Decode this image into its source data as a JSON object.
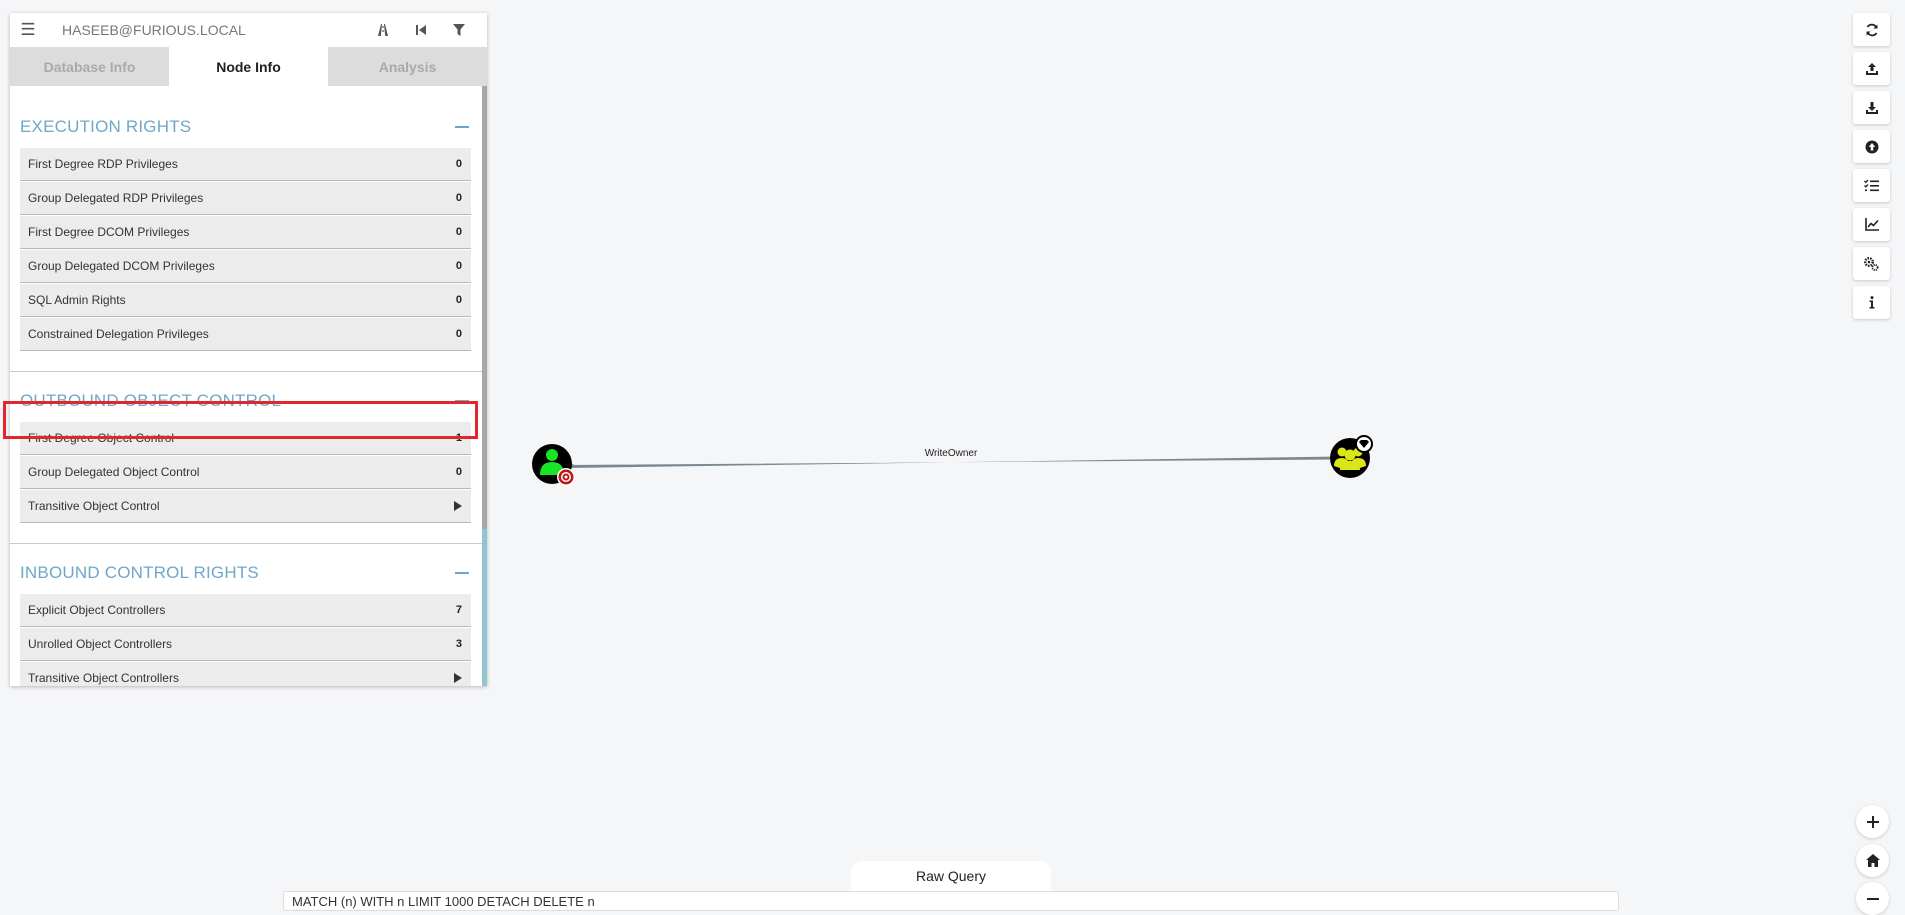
{
  "search": {
    "value": "HASEEB@FURIOUS.LOCAL"
  },
  "tabs": [
    {
      "label": "Database Info",
      "active": false
    },
    {
      "label": "Node Info",
      "active": true
    },
    {
      "label": "Analysis",
      "active": false
    }
  ],
  "sections": [
    {
      "title": "EXECUTION RIGHTS",
      "rows": [
        {
          "label": "First Degree RDP Privileges",
          "value": "0"
        },
        {
          "label": "Group Delegated RDP Privileges",
          "value": "0"
        },
        {
          "label": "First Degree DCOM Privileges",
          "value": "0"
        },
        {
          "label": "Group Delegated DCOM Privileges",
          "value": "0"
        },
        {
          "label": "SQL Admin Rights",
          "value": "0"
        },
        {
          "label": "Constrained Delegation Privileges",
          "value": "0"
        }
      ]
    },
    {
      "title": "OUTBOUND OBJECT CONTROL",
      "rows": [
        {
          "label": "First Degree Object Control",
          "value": "1"
        },
        {
          "label": "Group Delegated Object Control",
          "value": "0"
        },
        {
          "label": "Transitive Object Control",
          "value": ""
        }
      ]
    },
    {
      "title": "INBOUND CONTROL RIGHTS",
      "rows": [
        {
          "label": "Explicit Object Controllers",
          "value": "7"
        },
        {
          "label": "Unrolled Object Controllers",
          "value": "3"
        },
        {
          "label": "Transitive Object Controllers",
          "value": ""
        }
      ]
    }
  ],
  "graph": {
    "edge_label": "WriteOwner",
    "source_node_icon": "user-icon",
    "target_node_icon": "group-icon",
    "colors": {
      "user": "#17e625",
      "group": "#dbe617",
      "edge": "#7b8891",
      "highlight": "#e3262b"
    }
  },
  "toolbar_icons": [
    "refresh-icon",
    "upload-icon",
    "download-icon",
    "arrow-up-circle-icon",
    "checklist-icon",
    "line-chart-icon",
    "settings-icon",
    "info-icon"
  ],
  "zoom_icons": [
    "zoom-in-icon",
    "home-icon",
    "zoom-out-icon"
  ],
  "raw_query": {
    "tab_label": "Raw Query",
    "value": "MATCH (n) WITH n LIMIT 1000 DETACH DELETE n"
  }
}
